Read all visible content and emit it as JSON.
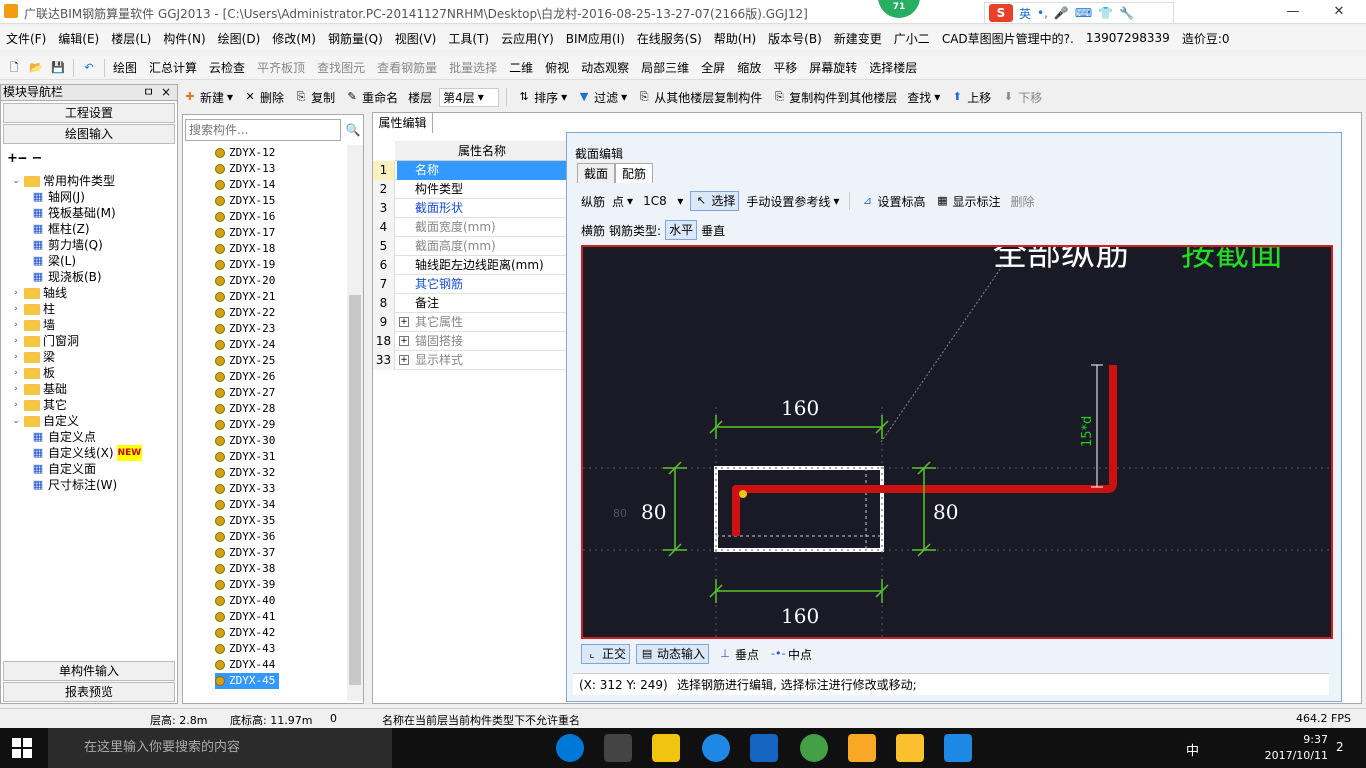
{
  "title": "广联达BIM钢筋算量软件 GGJ2013 - [C:\\Users\\Administrator.PC-20141127NRHM\\Desktop\\白龙村-2016-08-25-13-27-07(2166版).GGJ12]",
  "notif_count": "71",
  "ime": {
    "lang": "英",
    "punct": "•,"
  },
  "menu": [
    "文件(F)",
    "编辑(E)",
    "楼层(L)",
    "构件(N)",
    "绘图(D)",
    "修改(M)",
    "钢筋量(Q)",
    "视图(V)",
    "工具(T)",
    "云应用(Y)",
    "BIM应用(I)",
    "在线服务(S)",
    "帮助(H)",
    "版本号(B)",
    "新建变更",
    "广小二",
    "CAD草图图片管理中的?.",
    "13907298339",
    "造价豆:0"
  ],
  "toolbar1": [
    "绘图",
    "汇总计算",
    "云检查",
    "平齐板顶",
    "查找图元",
    "查看钢筋量",
    "批量选择",
    "二维",
    "俯视",
    "动态观察",
    "局部三维",
    "全屏",
    "缩放",
    "平移",
    "屏幕旋转",
    "选择楼层"
  ],
  "toolbar2": {
    "new": "新建",
    "delete": "删除",
    "copy": "复制",
    "rename": "重命名",
    "floor_label": "楼层",
    "floor_value": "第4层",
    "sort": "排序",
    "filter": "过滤",
    "copy_from": "从其他楼层复制构件",
    "copy_to": "复制构件到其他楼层",
    "find": "查找",
    "up": "上移",
    "down": "下移"
  },
  "nav": {
    "title": "模块导航栏",
    "project_settings": "工程设置",
    "drawing_input": "绘图输入",
    "single_input": "单构件输入",
    "report": "报表预览",
    "pin": "ㅁ",
    "close": "×"
  },
  "tree": [
    {
      "label": "常用构件类型",
      "level": 0,
      "exp": "⌄"
    },
    {
      "label": "轴网(J)",
      "level": 1
    },
    {
      "label": "筏板基础(M)",
      "level": 1
    },
    {
      "label": "框柱(Z)",
      "level": 1
    },
    {
      "label": "剪力墙(Q)",
      "level": 1
    },
    {
      "label": "梁(L)",
      "level": 1
    },
    {
      "label": "现浇板(B)",
      "level": 1
    },
    {
      "label": "轴线",
      "level": 0,
      "exp": "›"
    },
    {
      "label": "柱",
      "level": 0,
      "exp": "›"
    },
    {
      "label": "墙",
      "level": 0,
      "exp": "›"
    },
    {
      "label": "门窗洞",
      "level": 0,
      "exp": "›"
    },
    {
      "label": "梁",
      "level": 0,
      "exp": "›"
    },
    {
      "label": "板",
      "level": 0,
      "exp": "›"
    },
    {
      "label": "基础",
      "level": 0,
      "exp": "›"
    },
    {
      "label": "其它",
      "level": 0,
      "exp": "›"
    },
    {
      "label": "自定义",
      "level": 0,
      "exp": "⌄"
    },
    {
      "label": "自定义点",
      "level": 1
    },
    {
      "label": "自定义线(X)",
      "level": 1,
      "badge": "NEW"
    },
    {
      "label": "自定义面",
      "level": 1
    },
    {
      "label": "尺寸标注(W)",
      "level": 1
    }
  ],
  "search_placeholder": "搜索构件...",
  "components": [
    "ZDYX-12",
    "ZDYX-13",
    "ZDYX-14",
    "ZDYX-15",
    "ZDYX-16",
    "ZDYX-17",
    "ZDYX-18",
    "ZDYX-19",
    "ZDYX-20",
    "ZDYX-21",
    "ZDYX-22",
    "ZDYX-23",
    "ZDYX-24",
    "ZDYX-25",
    "ZDYX-26",
    "ZDYX-27",
    "ZDYX-28",
    "ZDYX-29",
    "ZDYX-30",
    "ZDYX-31",
    "ZDYX-32",
    "ZDYX-33",
    "ZDYX-34",
    "ZDYX-35",
    "ZDYX-36",
    "ZDYX-37",
    "ZDYX-38",
    "ZDYX-39",
    "ZDYX-40",
    "ZDYX-41",
    "ZDYX-42",
    "ZDYX-43",
    "ZDYX-44",
    "ZDYX-45"
  ],
  "prop_tab": "属性编辑",
  "prop_header": "属性名称",
  "props": [
    {
      "n": "1",
      "l": "名称",
      "style": "sel"
    },
    {
      "n": "2",
      "l": "构件类型",
      "style": ""
    },
    {
      "n": "3",
      "l": "截面形状",
      "style": "blue"
    },
    {
      "n": "4",
      "l": "截面宽度(mm)",
      "style": "grey"
    },
    {
      "n": "5",
      "l": "截面高度(mm)",
      "style": "grey"
    },
    {
      "n": "6",
      "l": "轴线距左边线距离(mm)",
      "style": ""
    },
    {
      "n": "7",
      "l": "其它钢筋",
      "style": "blue"
    },
    {
      "n": "8",
      "l": "备注",
      "style": ""
    },
    {
      "n": "9",
      "l": "其它属性",
      "style": "grey",
      "plus": "+"
    },
    {
      "n": "18",
      "l": "锚固搭接",
      "style": "grey",
      "plus": "+"
    },
    {
      "n": "33",
      "l": "显示样式",
      "style": "grey",
      "plus": "+"
    }
  ],
  "dialog": {
    "title": "截面编辑",
    "tabs": [
      "截面",
      "配筋"
    ],
    "tb1": {
      "long": "纵筋",
      "point": "点",
      "spec": "1C8",
      "select": "选择",
      "ref": "手动设置参考线",
      "elev": "设置标高",
      "show": "显示标注",
      "del": "删除"
    },
    "tb2": {
      "stirrup": "横筋",
      "type": "钢筋类型:",
      "horiz": "水平",
      "vert": "垂直"
    },
    "canvas": {
      "banner_white": "全部纵筋",
      "banner_green": "按截面",
      "top": "160",
      "bottom": "160",
      "left": "80",
      "right": "80",
      "small": "80",
      "hook": "15*d"
    },
    "bottom": {
      "ortho": "正交",
      "dyn": "动态输入",
      "perp": "垂点",
      "mid": "中点"
    },
    "coord": "(X: 312 Y: 249)",
    "hint": "选择钢筋进行编辑, 选择标注进行修改或移动;"
  },
  "status": {
    "floor_h": "层高: 2.8m",
    "base_h": "底标高: 11.97m",
    "zero": "0",
    "msg": "名称在当前层当前构件类型下不允许重名",
    "fps": "464.2 FPS"
  },
  "taskbar": {
    "search": "在这里输入你要搜索的内容",
    "time": "9:37",
    "date": "2017/10/11",
    "ime": "中",
    "notif": "2"
  },
  "colors": {
    "canvas_bg": "#1a1a26",
    "rebar": "#cc1111",
    "dim": "#58c42a",
    "frame": "#ffffff",
    "selection": "#3399ff"
  }
}
